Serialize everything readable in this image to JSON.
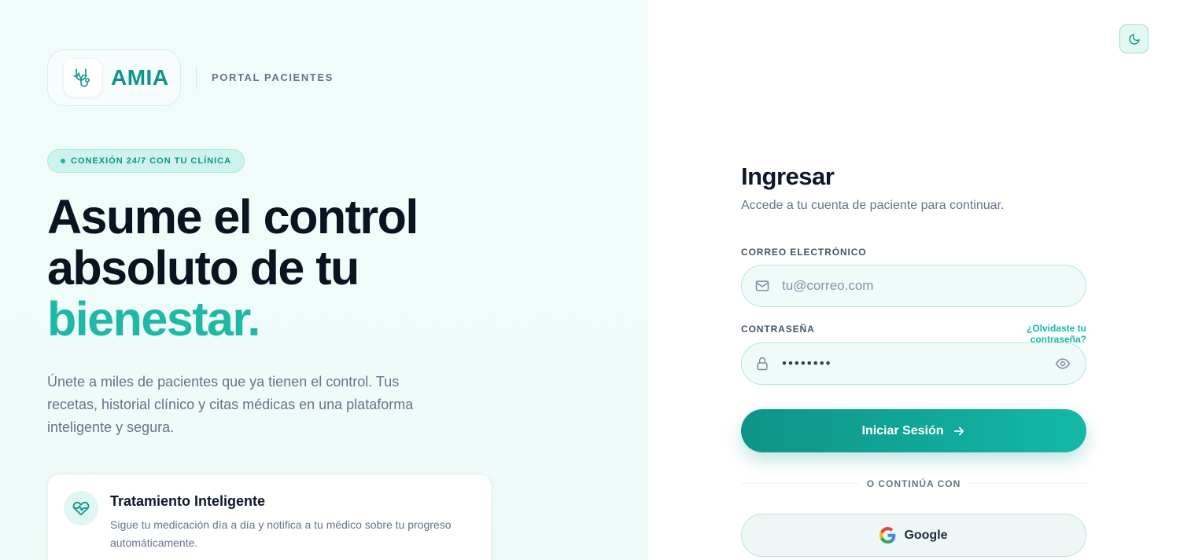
{
  "brand": {
    "name": "AMIA",
    "logo_icon": "stethoscope-heartbeat-icon",
    "portal_label": "PORTAL PACIENTES"
  },
  "hero": {
    "badge": "CONEXIÓN 24/7 CON TU CLÍNICA",
    "headline_line1": "Asume el control",
    "headline_line2": "absoluto de tu",
    "headline_accent": "bienestar.",
    "subcopy": "Únete a miles de pacientes que ya tienen el control. Tus recetas, historial clínico y citas médicas en una plataforma inteligente y segura."
  },
  "feature": {
    "icon": "heart-pulse-icon",
    "title": "Tratamiento Inteligente",
    "description": "Sigue tu medicación día a día y notifica a tu médico sobre tu progreso automáticamente."
  },
  "theme_toggle": {
    "icon": "moon-icon"
  },
  "login": {
    "title": "Ingresar",
    "subtitle": "Accede a tu cuenta de paciente para continuar.",
    "email_label": "CORREO ELECTRÓNICO",
    "email_placeholder": "tu@correo.com",
    "email_icon": "mail-icon",
    "password_label": "CONTRASEÑA",
    "password_value": "••••••••",
    "password_icon": "lock-icon",
    "show_password_icon": "eye-icon",
    "forgot_link": "¿Olvidaste tu contraseña?",
    "submit_label": "Iniciar Sesión",
    "submit_icon": "arrow-right-icon",
    "divider": "O CONTINÚA CON",
    "google_label": "Google",
    "google_icon": "google-icon"
  },
  "colors": {
    "accent": "#14b8a6",
    "accent_dark": "#0d9488",
    "heading": "#0f172a",
    "muted": "#64748b"
  }
}
